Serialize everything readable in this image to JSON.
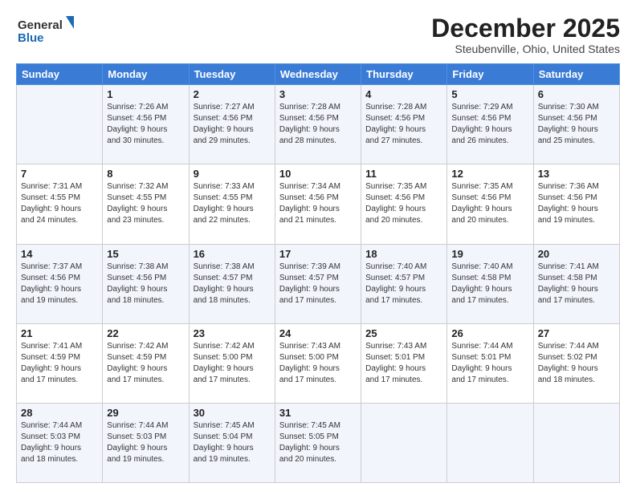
{
  "header": {
    "logo_general": "General",
    "logo_blue": "Blue",
    "main_title": "December 2025",
    "subtitle": "Steubenville, Ohio, United States"
  },
  "days": [
    "Sunday",
    "Monday",
    "Tuesday",
    "Wednesday",
    "Thursday",
    "Friday",
    "Saturday"
  ],
  "weeks": [
    [
      {
        "num": "",
        "info": ""
      },
      {
        "num": "1",
        "info": "Sunrise: 7:26 AM\nSunset: 4:56 PM\nDaylight: 9 hours\nand 30 minutes."
      },
      {
        "num": "2",
        "info": "Sunrise: 7:27 AM\nSunset: 4:56 PM\nDaylight: 9 hours\nand 29 minutes."
      },
      {
        "num": "3",
        "info": "Sunrise: 7:28 AM\nSunset: 4:56 PM\nDaylight: 9 hours\nand 28 minutes."
      },
      {
        "num": "4",
        "info": "Sunrise: 7:28 AM\nSunset: 4:56 PM\nDaylight: 9 hours\nand 27 minutes."
      },
      {
        "num": "5",
        "info": "Sunrise: 7:29 AM\nSunset: 4:56 PM\nDaylight: 9 hours\nand 26 minutes."
      },
      {
        "num": "6",
        "info": "Sunrise: 7:30 AM\nSunset: 4:56 PM\nDaylight: 9 hours\nand 25 minutes."
      }
    ],
    [
      {
        "num": "7",
        "info": "Sunrise: 7:31 AM\nSunset: 4:55 PM\nDaylight: 9 hours\nand 24 minutes."
      },
      {
        "num": "8",
        "info": "Sunrise: 7:32 AM\nSunset: 4:55 PM\nDaylight: 9 hours\nand 23 minutes."
      },
      {
        "num": "9",
        "info": "Sunrise: 7:33 AM\nSunset: 4:55 PM\nDaylight: 9 hours\nand 22 minutes."
      },
      {
        "num": "10",
        "info": "Sunrise: 7:34 AM\nSunset: 4:56 PM\nDaylight: 9 hours\nand 21 minutes."
      },
      {
        "num": "11",
        "info": "Sunrise: 7:35 AM\nSunset: 4:56 PM\nDaylight: 9 hours\nand 20 minutes."
      },
      {
        "num": "12",
        "info": "Sunrise: 7:35 AM\nSunset: 4:56 PM\nDaylight: 9 hours\nand 20 minutes."
      },
      {
        "num": "13",
        "info": "Sunrise: 7:36 AM\nSunset: 4:56 PM\nDaylight: 9 hours\nand 19 minutes."
      }
    ],
    [
      {
        "num": "14",
        "info": "Sunrise: 7:37 AM\nSunset: 4:56 PM\nDaylight: 9 hours\nand 19 minutes."
      },
      {
        "num": "15",
        "info": "Sunrise: 7:38 AM\nSunset: 4:56 PM\nDaylight: 9 hours\nand 18 minutes."
      },
      {
        "num": "16",
        "info": "Sunrise: 7:38 AM\nSunset: 4:57 PM\nDaylight: 9 hours\nand 18 minutes."
      },
      {
        "num": "17",
        "info": "Sunrise: 7:39 AM\nSunset: 4:57 PM\nDaylight: 9 hours\nand 17 minutes."
      },
      {
        "num": "18",
        "info": "Sunrise: 7:40 AM\nSunset: 4:57 PM\nDaylight: 9 hours\nand 17 minutes."
      },
      {
        "num": "19",
        "info": "Sunrise: 7:40 AM\nSunset: 4:58 PM\nDaylight: 9 hours\nand 17 minutes."
      },
      {
        "num": "20",
        "info": "Sunrise: 7:41 AM\nSunset: 4:58 PM\nDaylight: 9 hours\nand 17 minutes."
      }
    ],
    [
      {
        "num": "21",
        "info": "Sunrise: 7:41 AM\nSunset: 4:59 PM\nDaylight: 9 hours\nand 17 minutes."
      },
      {
        "num": "22",
        "info": "Sunrise: 7:42 AM\nSunset: 4:59 PM\nDaylight: 9 hours\nand 17 minutes."
      },
      {
        "num": "23",
        "info": "Sunrise: 7:42 AM\nSunset: 5:00 PM\nDaylight: 9 hours\nand 17 minutes."
      },
      {
        "num": "24",
        "info": "Sunrise: 7:43 AM\nSunset: 5:00 PM\nDaylight: 9 hours\nand 17 minutes."
      },
      {
        "num": "25",
        "info": "Sunrise: 7:43 AM\nSunset: 5:01 PM\nDaylight: 9 hours\nand 17 minutes."
      },
      {
        "num": "26",
        "info": "Sunrise: 7:44 AM\nSunset: 5:01 PM\nDaylight: 9 hours\nand 17 minutes."
      },
      {
        "num": "27",
        "info": "Sunrise: 7:44 AM\nSunset: 5:02 PM\nDaylight: 9 hours\nand 18 minutes."
      }
    ],
    [
      {
        "num": "28",
        "info": "Sunrise: 7:44 AM\nSunset: 5:03 PM\nDaylight: 9 hours\nand 18 minutes."
      },
      {
        "num": "29",
        "info": "Sunrise: 7:44 AM\nSunset: 5:03 PM\nDaylight: 9 hours\nand 19 minutes."
      },
      {
        "num": "30",
        "info": "Sunrise: 7:45 AM\nSunset: 5:04 PM\nDaylight: 9 hours\nand 19 minutes."
      },
      {
        "num": "31",
        "info": "Sunrise: 7:45 AM\nSunset: 5:05 PM\nDaylight: 9 hours\nand 20 minutes."
      },
      {
        "num": "",
        "info": ""
      },
      {
        "num": "",
        "info": ""
      },
      {
        "num": "",
        "info": ""
      }
    ]
  ]
}
